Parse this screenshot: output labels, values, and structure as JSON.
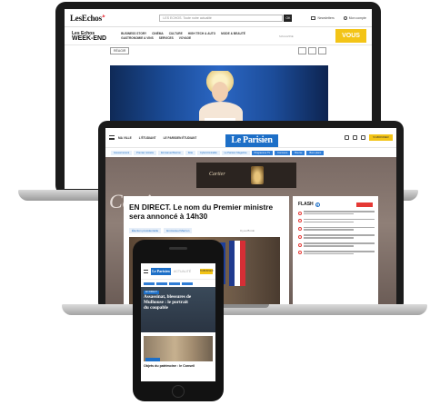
{
  "les_echos": {
    "logo": "LesEchos",
    "logo_suffix": ".fr",
    "search_placeholder": "LES ECHOS. Toute notre actualité",
    "search_ok": "OK",
    "util_newsletters": "Newsletters",
    "util_account": "Mon compte",
    "weekend_line1": "Les Echos",
    "weekend_line2": "WEEK-END",
    "nav": [
      "BUSINESS STORY",
      "CINÉMA",
      "CULTURE",
      "HIGH TECH & AUTO",
      "MODE & BEAUTÉ",
      "GASTRONOMIE & VINS",
      "SERVICES",
      "VOYAGE"
    ],
    "magazine_label": "MAGAZINE",
    "vous_label": "VOUS",
    "back_button": "RÉAGIR"
  },
  "le_parisien": {
    "logo": "Le Parisien",
    "links": [
      "MA VILLE",
      "L'ÉTUDIANT",
      "LE PARISIEN ÉTUDIANT"
    ],
    "subscribe": "S'ABONNER",
    "tabs": [
      "Gouvernement",
      "Premier ministre",
      "Emmanuel Macron",
      "Fête",
      "Cybercriminalité",
      "Le Parisien Magazine",
      "Programme TV",
      "Concours",
      "Bourse",
      "Bons plans"
    ],
    "hero_brand_left": "Cartier",
    "hero_brand_right": "RE",
    "ad_text": "Cartier",
    "headline_live": "EN DIRECT.",
    "headline_text": " Le nom du Premier ministre sera annoncé à 14h30",
    "pills": [
      "Élection présidentielle",
      "Emmanuel Macron"
    ],
    "meta": "Il y a 25 min",
    "flash_title": "FLASH",
    "flash_count": "3"
  },
  "phone": {
    "logo": "Le Parisien",
    "section": "ACTUALITÉ",
    "subscribe": "S'ABONNER",
    "badge": "EN DIRECT",
    "headline": "Assassinat, blessures de Mulhouse : le portrait du coupable",
    "card_title": "Objets du patrimoine : le Conseil"
  }
}
